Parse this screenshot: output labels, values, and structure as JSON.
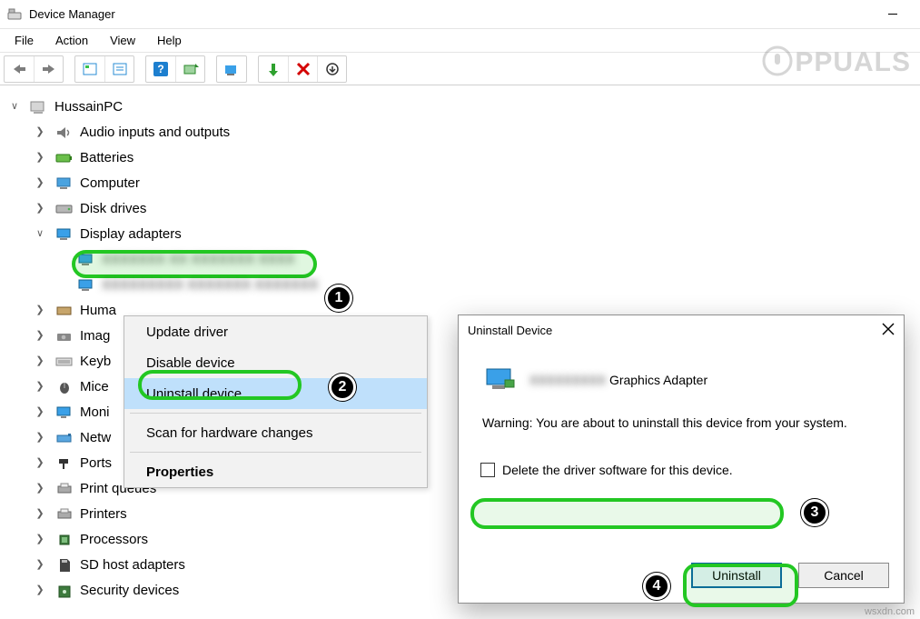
{
  "window": {
    "title": "Device Manager"
  },
  "menus": {
    "file": "File",
    "action": "Action",
    "view": "View",
    "help": "Help"
  },
  "watermark": "PPUALS",
  "credit": "wsxdn.com",
  "tree": {
    "root": "HussainPC",
    "items": [
      {
        "label": "Audio inputs and outputs"
      },
      {
        "label": "Batteries"
      },
      {
        "label": "Computer"
      },
      {
        "label": "Disk drives"
      },
      {
        "label": "Display adapters",
        "expanded": true,
        "children": [
          {
            "label": "Intel(R) HD Graphics (blurred)",
            "blurred": true
          },
          {
            "label": "Secondary Graphics (blurred)",
            "blurred": true,
            "selected": true
          }
        ]
      },
      {
        "label": "Huma",
        "truncated": true,
        "full": "Human Interface Devices"
      },
      {
        "label": "Imag",
        "truncated": true,
        "full": "Imaging devices"
      },
      {
        "label": "Keyb",
        "truncated": true,
        "full": "Keyboards"
      },
      {
        "label": "Mice",
        "truncated": true,
        "full": "Mice and other pointing devices"
      },
      {
        "label": "Moni",
        "truncated": true,
        "full": "Monitors"
      },
      {
        "label": "Netw",
        "truncated": true,
        "full": "Network adapters"
      },
      {
        "label": "Ports",
        "truncated": true,
        "full": "Ports (COM & LPT)"
      },
      {
        "label": "Print queues"
      },
      {
        "label": "Printers"
      },
      {
        "label": "Processors"
      },
      {
        "label": "SD host adapters"
      },
      {
        "label": "Security devices"
      }
    ]
  },
  "contextMenu": {
    "update": "Update driver",
    "disable": "Disable device",
    "uninstall": "Uninstall device",
    "scan": "Scan for hardware changes",
    "properties": "Properties"
  },
  "dialog": {
    "title": "Uninstall Device",
    "deviceNameSuffix": "Graphics Adapter",
    "warning": "Warning: You are about to uninstall this device from your system.",
    "checkboxLabel": "Delete the driver software for this device.",
    "uninstall": "Uninstall",
    "cancel": "Cancel"
  },
  "steps": {
    "s1": "1",
    "s2": "2",
    "s3": "3",
    "s4": "4"
  }
}
